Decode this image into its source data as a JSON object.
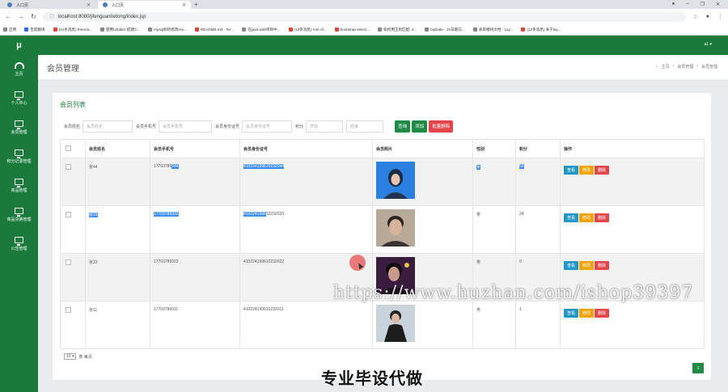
{
  "browser": {
    "tabs": [
      {
        "title": "入口页"
      },
      {
        "title": "入口页"
      }
    ],
    "new_tab": "+",
    "url": "localhost:8080/jifenguanlixitong/index.jsp",
    "bookmarks": [
      "应用",
      "百度翻译",
      "(12条消息) freema...",
      "使用UEditor 搭建C...",
      "mysql如何修改roo...",
      "README.md - Ter...",
      "在java web项目中...",
      "(12条消息) root of...",
      "bootstrap-select...",
      "如何用正则匹配: 2...",
      "layDate - JS日期与...",
      "表单模块文档 - Lay...",
      "(12条消息) 关于lay..."
    ]
  },
  "app": {
    "logo": "μ",
    "user": "a1 ▾",
    "sidebar": [
      {
        "label": "主页",
        "icon": "dashboard-icon"
      },
      {
        "label": "个人中心",
        "icon": "monitor-icon"
      },
      {
        "label": "会员管理",
        "icon": "monitor-icon"
      },
      {
        "label": "积分记录管理",
        "icon": "monitor-icon"
      },
      {
        "label": "商品管理",
        "icon": "monitor-icon"
      },
      {
        "label": "商品兑换管理",
        "icon": "monitor-icon"
      },
      {
        "label": "公告管理",
        "icon": "monitor-icon"
      }
    ],
    "page_title": "会员管理",
    "breadcrumb": {
      "home": "主页",
      "sep": "›",
      "level1": "会员管理",
      "level2": "会员管理"
    }
  },
  "panel": {
    "title": "会员列表",
    "filters": {
      "name_label": "会员姓名",
      "name_placeholder": "会员姓名",
      "phone_label": "会员手机号",
      "phone_placeholder": "会员手机号",
      "id_label": "会员身份证号",
      "id_placeholder": "会员身份证号",
      "points_label": "积分",
      "start_placeholder": "开始",
      "end_placeholder": "结束"
    },
    "buttons": {
      "search": "查询",
      "add": "添加",
      "batch_delete": "批量删除"
    },
    "columns": [
      "会员姓名",
      "会员手机号",
      "会员身份证号",
      "会员照片",
      "性别",
      "积分",
      "操作"
    ],
    "rows": [
      {
        "name": "张44",
        "phone_a": "17703786",
        "phone_b": "944",
        "id_a": "",
        "id_b": "410224199610232044",
        "gender": "女",
        "points": "50"
      },
      {
        "name": "张33",
        "phone_a": "",
        "phone_b": "17703786933",
        "id_a": "4102241996",
        "id_b": "10232033",
        "gender": "男",
        "points": "24"
      },
      {
        "name": "张22",
        "phone_a": "17703786922",
        "phone_b": "",
        "id_a": "410224199610232022",
        "id_b": "",
        "gender": "男",
        "points": "0"
      },
      {
        "name": "张11",
        "phone_a": "17703786911",
        "phone_b": "",
        "id_a": "410224199610232011",
        "id_b": "",
        "gender": "男",
        "points": "1"
      }
    ],
    "row_actions": {
      "view": "查看",
      "edit": "修改",
      "delete": "删除"
    },
    "pager": {
      "page_size": "10 ▾",
      "suffix": "条 每页",
      "current_page": "1"
    }
  },
  "overlay": {
    "watermark": "https://www.huzhan.com/ishop39397",
    "caption": "专业毕设代做"
  },
  "colors": {
    "brand_green": "#1a7a3c",
    "view": "#2197c8",
    "edit": "#f0a30a",
    "delete": "#e3464a"
  }
}
